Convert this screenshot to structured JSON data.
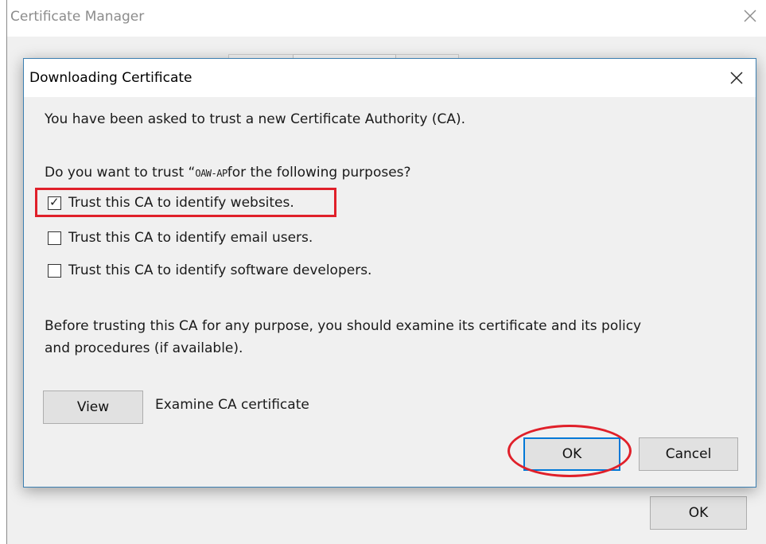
{
  "background_window": {
    "title": "Certificate Manager",
    "ok_label": "OK"
  },
  "dialog": {
    "title": "Downloading Certificate",
    "intro": "You have been asked to trust a new Certificate Authority (CA).",
    "question_prefix": "Do you want to trust “",
    "question_subject": "OAW-AP",
    "question_suffix": "for the following purposes?",
    "checkboxes": [
      {
        "label": "Trust this CA to identify websites.",
        "checked": true
      },
      {
        "label": "Trust this CA to identify email users.",
        "checked": false
      },
      {
        "label": "Trust this CA to identify software developers.",
        "checked": false
      }
    ],
    "advice_line1": "Before trusting this CA for any purpose, you should examine its certificate and its policy",
    "advice_line2": "and procedures (if available).",
    "view_label": "View",
    "view_caption": "Examine CA certificate",
    "ok_label": "OK",
    "cancel_label": "Cancel"
  },
  "colors": {
    "annotation": "#e0202a",
    "focus_border": "#0078d7",
    "dialog_border": "#3c7fb1"
  },
  "icons": {
    "close": "close-icon",
    "check": "checkmark-icon"
  }
}
